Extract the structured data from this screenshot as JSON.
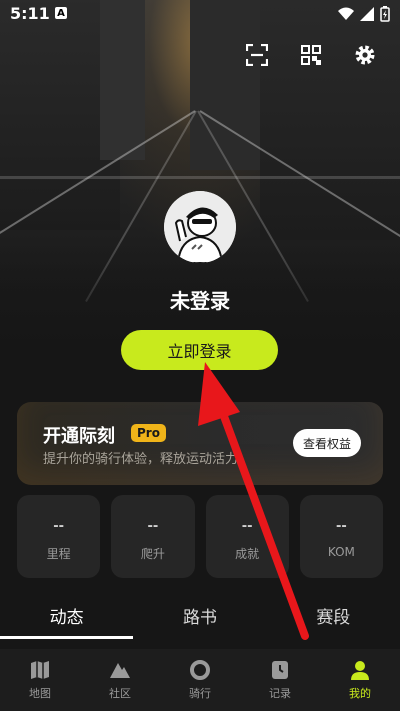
{
  "status_bar": {
    "time": "5:11",
    "notification_badge": "A"
  },
  "profile": {
    "name": "未登录",
    "login_button": "立即登录"
  },
  "pro_card": {
    "title": "开通际刻",
    "badge": "Pro",
    "subtitle": "提升你的骑行体验，释放运动活力",
    "button": "查看权益"
  },
  "stats": [
    {
      "value": "--",
      "label": "里程"
    },
    {
      "value": "--",
      "label": "爬升"
    },
    {
      "value": "--",
      "label": "成就"
    },
    {
      "value": "--",
      "label": "KOM"
    }
  ],
  "tabs": [
    {
      "label": "动态",
      "active": true
    },
    {
      "label": "路书",
      "active": false
    },
    {
      "label": "赛段",
      "active": false
    }
  ],
  "bottom_nav": [
    {
      "label": "地图",
      "icon": "map-icon"
    },
    {
      "label": "社区",
      "icon": "mountain-icon"
    },
    {
      "label": "骑行",
      "icon": "record-ring-icon"
    },
    {
      "label": "记录",
      "icon": "clock-file-icon"
    },
    {
      "label": "我的",
      "icon": "person-icon",
      "active": true
    }
  ],
  "colors": {
    "accent": "#c8ea1d",
    "pro_badge": "#f0b419",
    "annotation_arrow": "#e8171b"
  }
}
